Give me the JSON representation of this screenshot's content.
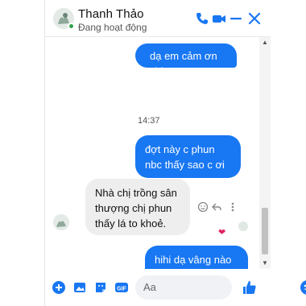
{
  "header": {
    "name": "Thanh Thảo",
    "status": "Đang hoạt động"
  },
  "messages": [
    {
      "direction": "out",
      "text": "dạ em cảm ơn chị ạ"
    },
    {
      "direction": "time",
      "text": "14:37"
    },
    {
      "direction": "out",
      "text": "đợt này c phun nbc thấy sao c ơi"
    },
    {
      "direction": "in",
      "text": "Nhà chị trồng sân thượng chị phun thấy lá to khoẻ."
    },
    {
      "direction": "out",
      "text": "hihi dạ vâng nào c cho e xin ít ảnh vườn nhà mình nha c"
    }
  ],
  "reaction": "❤",
  "composer": {
    "placeholder": "Aa"
  },
  "colors": {
    "accent": "#1877f2",
    "incoming_bubble": "#eeeeee",
    "online": "#31a24c",
    "heart": "#e0245e"
  },
  "icons": [
    "phone-icon",
    "video-icon",
    "minimize-icon",
    "close-icon",
    "plus-icon",
    "photo-icon",
    "sticker-icon",
    "gif-icon",
    "emoji-icon",
    "like-icon",
    "smile-icon",
    "reply-icon",
    "more-icon"
  ]
}
